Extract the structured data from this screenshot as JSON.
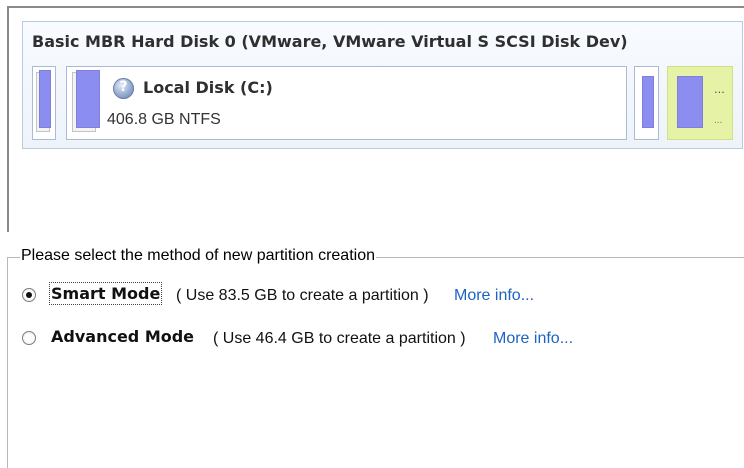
{
  "disk": {
    "title": "Basic MBR Hard Disk 0 (VMware, VMware Virtual S SCSI Disk Dev)",
    "partition": {
      "name": "Local Disk (C:)",
      "size": "406.8 GB NTFS",
      "icon": "disk-question-icon"
    },
    "free_tile": {
      "label_top": "...",
      "label_bottom": "..."
    },
    "colors": {
      "partition_block": "#8b8ef0",
      "free_tile": "#e6f3a6",
      "tile_border": "#a9bcd4"
    }
  },
  "method_group": {
    "legend": "Please select the method of new partition creation",
    "options": [
      {
        "label": "Smart Mode",
        "description": "( Use 83.5 GB to create a partition )",
        "link": "More info...",
        "selected": true
      },
      {
        "label": "Advanced Mode",
        "description": "( Use 46.4 GB to create a partition )",
        "link": "More info...",
        "selected": false
      }
    ],
    "link_color": "#1c63c4"
  }
}
